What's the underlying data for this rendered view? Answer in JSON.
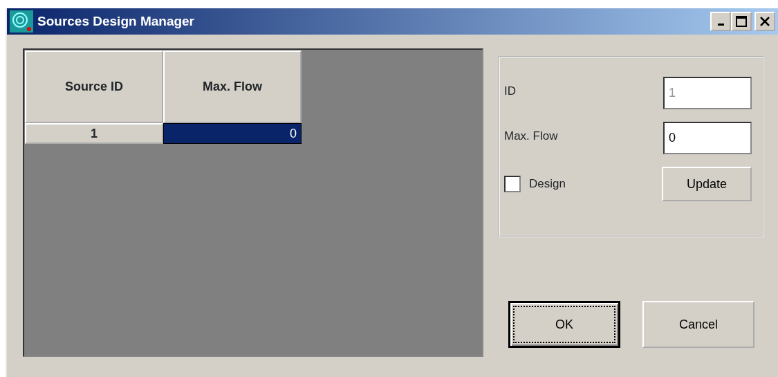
{
  "window": {
    "title": "Sources Design Manager"
  },
  "table": {
    "columns": [
      "Source ID",
      "Max. Flow"
    ],
    "rows": [
      {
        "cells": [
          {
            "text": "1",
            "selected": false
          },
          {
            "text": "0",
            "selected": true
          }
        ]
      }
    ]
  },
  "form": {
    "fields": [
      {
        "label": "ID",
        "value": "1",
        "disabled": true
      },
      {
        "label": "Max. Flow",
        "value": "0",
        "disabled": false
      }
    ],
    "design": {
      "label": "Design",
      "checked": false
    },
    "update_button": "Update"
  },
  "buttons": [
    {
      "label": "OK",
      "default": true
    },
    {
      "label": "Cancel",
      "default": false
    }
  ]
}
